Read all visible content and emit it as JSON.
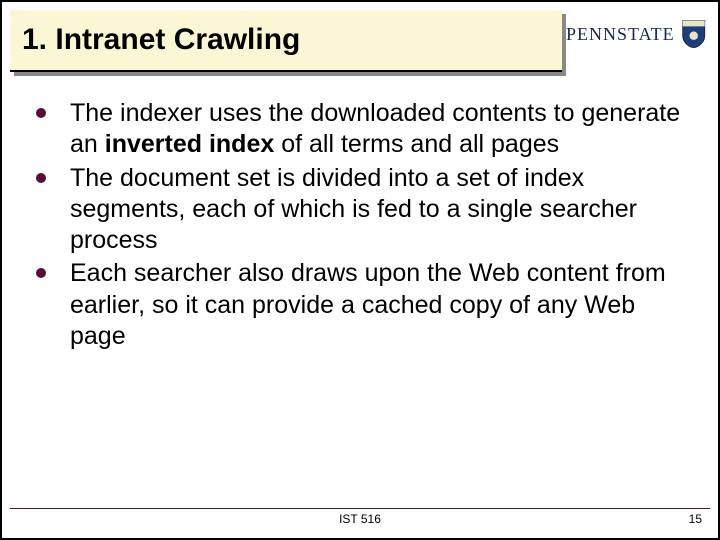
{
  "title": "1. Intranet Crawling",
  "logo": {
    "text": "PENNSTATE"
  },
  "bullets": [
    {
      "pre": "The indexer uses the downloaded contents to generate an ",
      "bold": "inverted index",
      "post": " of all terms and all pages"
    },
    {
      "pre": "The document set is divided into a set of index segments, each of which is fed to a single searcher process",
      "bold": "",
      "post": ""
    },
    {
      "pre": "Each searcher also draws upon the Web content from earlier, so it can provide a cached copy of any Web page",
      "bold": "",
      "post": ""
    }
  ],
  "footer": {
    "center": "IST 516",
    "page": "15"
  }
}
